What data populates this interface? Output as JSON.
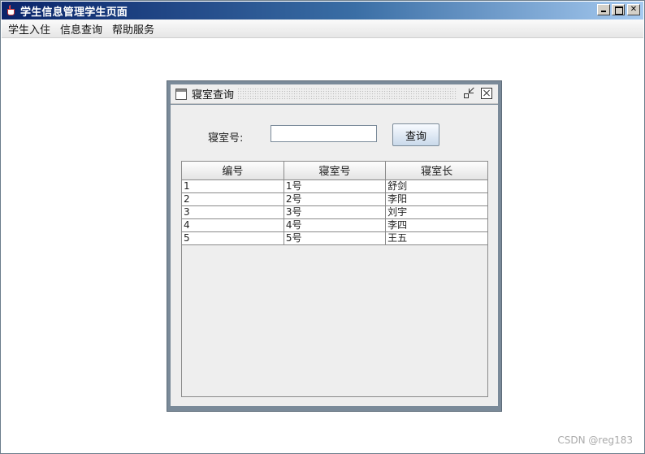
{
  "window": {
    "title": "学生信息管理学生页面",
    "icon": "java-cup-icon"
  },
  "menu": {
    "items": [
      "学生入住",
      "信息查询",
      "帮助服务"
    ]
  },
  "dialog": {
    "title": "寝室查询",
    "search_label": "寝室号:",
    "search_value": "",
    "search_button": "查询"
  },
  "table": {
    "headers": [
      "编号",
      "寝室号",
      "寝室长"
    ],
    "rows": [
      [
        "1",
        "1号",
        "舒剑"
      ],
      [
        "2",
        "2号",
        "李阳"
      ],
      [
        "3",
        "3号",
        "刘宇"
      ],
      [
        "4",
        "4号",
        "李四"
      ],
      [
        "5",
        "5号",
        "王五"
      ]
    ]
  },
  "watermark": "CSDN @reg183",
  "colors": {
    "titlebar_start": "#0a246a",
    "titlebar_end": "#a6caf0",
    "frame_border": "#7a8a99"
  }
}
